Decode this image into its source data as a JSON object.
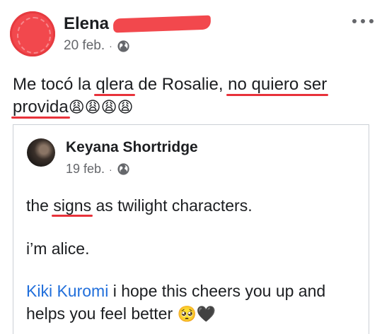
{
  "post": {
    "author": "Elena",
    "date": "20 feb.",
    "separator": "·",
    "privacy_icon": "globe-icon",
    "text_parts": {
      "p1": "Me tocó la ",
      "p2": "qlera",
      "p3": " de Rosalie, ",
      "p4": "no quiero ser",
      "p5": "provida",
      "p6": "😩😩😩😩"
    }
  },
  "shared_post": {
    "author": "Keyana Shortridge",
    "date": "19 feb.",
    "separator": "·",
    "privacy_icon": "globe-icon",
    "line1": {
      "a": "the ",
      "b": "signs",
      "c": " as twilight characters."
    },
    "line2": "i’m alice.",
    "line3": {
      "mention": "Kiki Kuromi",
      "text": " i hope this cheers you up and helps you feel better ",
      "emoji": "🥺🖤"
    }
  },
  "colors": {
    "redaction": "#f2484d",
    "underline_annotation": "#e8323a",
    "mention_link": "#216fdb",
    "meta_gray": "#65676b"
  }
}
